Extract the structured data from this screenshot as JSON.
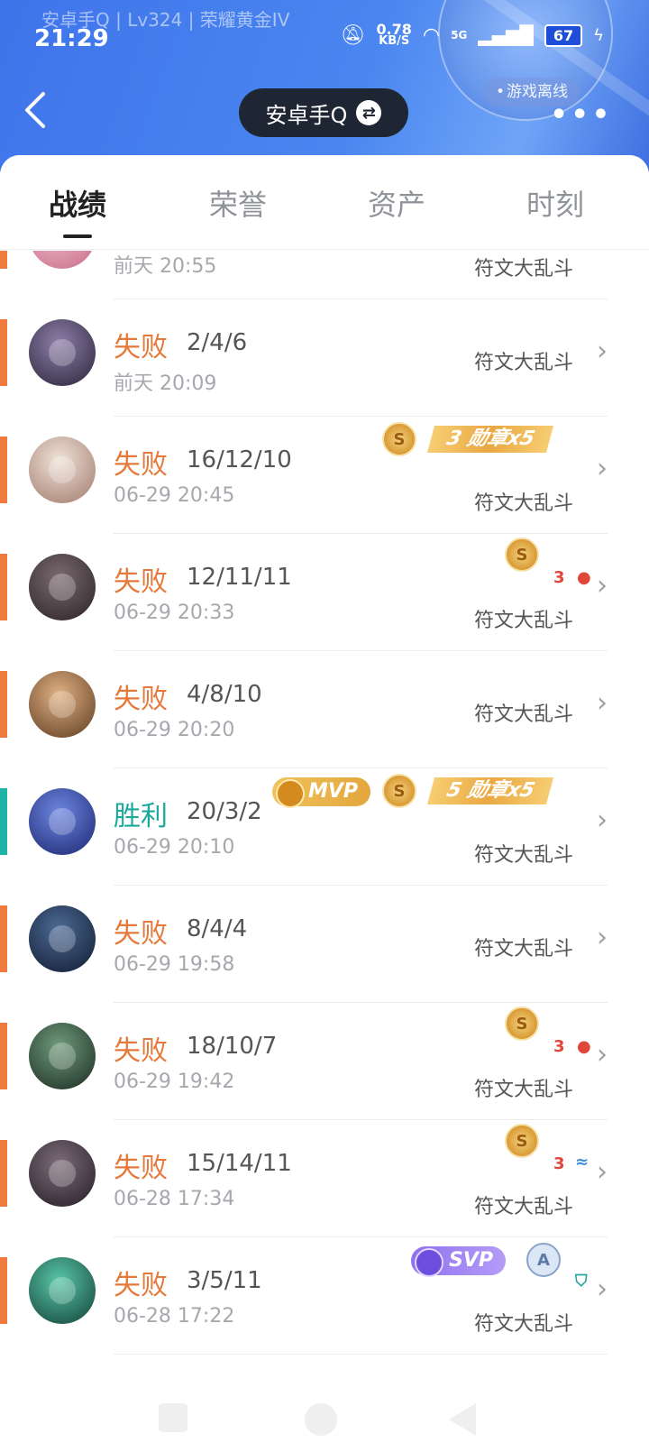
{
  "status_bar": {
    "subtitle": "安卓手Q | Lv324 | 荣耀黄金IV",
    "time": "21:29",
    "net_speed": "0.78",
    "net_unit": "KB/S",
    "network": "5G",
    "battery": "67"
  },
  "header": {
    "title": "安卓手Q",
    "offline_label": "游戏离线"
  },
  "tabs": [
    {
      "label": "战绩"
    },
    {
      "label": "荣誉"
    },
    {
      "label": "资产"
    },
    {
      "label": "时刻"
    }
  ],
  "matches": [
    {
      "result": "",
      "kda": "",
      "time": "前天 20:55",
      "mode": "符文大乱斗",
      "outcome": "loss",
      "avatar_color": "#e9a0b4"
    },
    {
      "result": "失败",
      "kda": "2/4/6",
      "time": "前天 20:09",
      "mode": "符文大乱斗",
      "outcome": "loss",
      "avatar_color": "#3b3550"
    },
    {
      "result": "失败",
      "kda": "16/12/10",
      "time": "06-29 20:45",
      "mode": "符文大乱斗",
      "outcome": "loss",
      "avatar_color": "#c9b5a7",
      "badges": {
        "coin": "S",
        "medal": "3 勋章x5"
      }
    },
    {
      "result": "失败",
      "kda": "12/11/11",
      "time": "06-29 20:33",
      "mode": "符文大乱斗",
      "outcome": "loss",
      "avatar_color": "#4a3a3f",
      "badges": {
        "coin": "S",
        "small": "3"
      }
    },
    {
      "result": "失败",
      "kda": "4/8/10",
      "time": "06-29 20:20",
      "mode": "符文大乱斗",
      "outcome": "loss",
      "avatar_color": "#8a5d3b"
    },
    {
      "result": "胜利",
      "kda": "20/3/2",
      "time": "06-29 20:10",
      "mode": "符文大乱斗",
      "outcome": "win",
      "avatar_color": "#2a3f8f",
      "badges": {
        "mvp": "MVP",
        "coin": "S",
        "medal": "5 勋章x5"
      }
    },
    {
      "result": "失败",
      "kda": "8/4/4",
      "time": "06-29 19:58",
      "mode": "符文大乱斗",
      "outcome": "loss",
      "avatar_color": "#1f3452"
    },
    {
      "result": "失败",
      "kda": "18/10/7",
      "time": "06-29 19:42",
      "mode": "符文大乱斗",
      "outcome": "loss",
      "avatar_color": "#2f4a3a",
      "badges": {
        "coin": "S",
        "small": "3"
      }
    },
    {
      "result": "失败",
      "kda": "15/14/11",
      "time": "06-28 17:34",
      "mode": "符文大乱斗",
      "outcome": "loss",
      "avatar_color": "#3e3440",
      "badges": {
        "coin": "S",
        "small": "3"
      }
    },
    {
      "result": "失败",
      "kda": "3/5/11",
      "time": "06-28 17:22",
      "mode": "符文大乱斗",
      "outcome": "loss",
      "avatar_color": "#1d6a5f",
      "badges": {
        "svp": "SVP",
        "grade": "A"
      }
    }
  ],
  "colors": {
    "header_blue": "#4a86f0",
    "loss": "#e5793b",
    "win": "#1aa99a"
  }
}
